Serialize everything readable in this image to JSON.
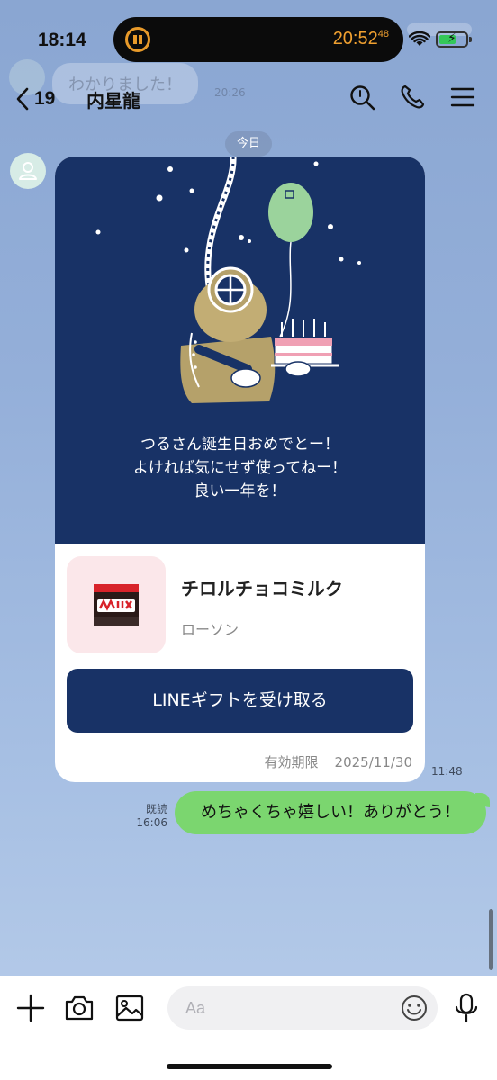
{
  "status_bar": {
    "time": "18:14",
    "timer_main": "20:52",
    "timer_sub": "48"
  },
  "ghost": {
    "previous_message": "わかりました！",
    "previous_time": "20:26"
  },
  "header": {
    "back_count": "19",
    "chat_name": "内星龍",
    "icons": [
      "search-icon",
      "phone-icon",
      "menu-icon"
    ]
  },
  "chat": {
    "date_label": "今日",
    "gift": {
      "message_lines": [
        "つるさん誕生日おめでとー！",
        "よければ気にせず使ってねー！",
        "良い一年を！"
      ],
      "product_name": "チロルチョコミルク",
      "store": "ローソン",
      "button_label": "LINEギフトを受け取る",
      "expiry_label": "有効期限",
      "expiry_date": "2025/11/30",
      "time": "11:48",
      "colors": {
        "card_navy": "#183266",
        "balloon": "#9bd39c"
      }
    },
    "sent": {
      "read_label": "既読",
      "time": "16:06",
      "text": "めちゃくちゃ嬉しい！ありがとう！",
      "bubble_color": "#7bd66f"
    }
  },
  "input_bar": {
    "placeholder": "Aa",
    "icons": [
      "plus-icon",
      "camera-icon",
      "image-icon",
      "emoji-icon",
      "mic-icon"
    ]
  }
}
